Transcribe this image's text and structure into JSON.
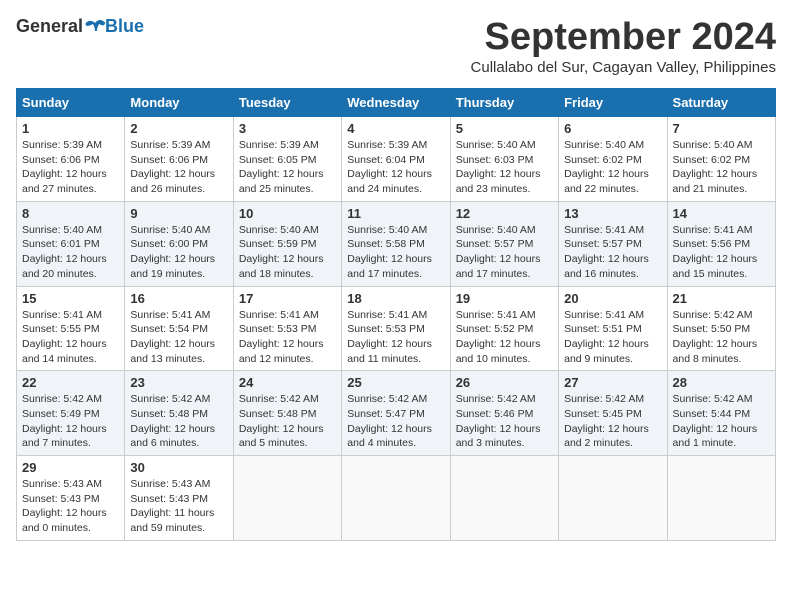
{
  "header": {
    "logo_general": "General",
    "logo_blue": "Blue",
    "month_title": "September 2024",
    "subtitle": "Cullalabo del Sur, Cagayan Valley, Philippines"
  },
  "weekdays": [
    "Sunday",
    "Monday",
    "Tuesday",
    "Wednesday",
    "Thursday",
    "Friday",
    "Saturday"
  ],
  "weeks": [
    [
      {
        "day": "1",
        "sunrise": "5:39 AM",
        "sunset": "6:06 PM",
        "daylight": "12 hours and 27 minutes."
      },
      {
        "day": "2",
        "sunrise": "5:39 AM",
        "sunset": "6:06 PM",
        "daylight": "12 hours and 26 minutes."
      },
      {
        "day": "3",
        "sunrise": "5:39 AM",
        "sunset": "6:05 PM",
        "daylight": "12 hours and 25 minutes."
      },
      {
        "day": "4",
        "sunrise": "5:39 AM",
        "sunset": "6:04 PM",
        "daylight": "12 hours and 24 minutes."
      },
      {
        "day": "5",
        "sunrise": "5:40 AM",
        "sunset": "6:03 PM",
        "daylight": "12 hours and 23 minutes."
      },
      {
        "day": "6",
        "sunrise": "5:40 AM",
        "sunset": "6:02 PM",
        "daylight": "12 hours and 22 minutes."
      },
      {
        "day": "7",
        "sunrise": "5:40 AM",
        "sunset": "6:02 PM",
        "daylight": "12 hours and 21 minutes."
      }
    ],
    [
      {
        "day": "8",
        "sunrise": "5:40 AM",
        "sunset": "6:01 PM",
        "daylight": "12 hours and 20 minutes."
      },
      {
        "day": "9",
        "sunrise": "5:40 AM",
        "sunset": "6:00 PM",
        "daylight": "12 hours and 19 minutes."
      },
      {
        "day": "10",
        "sunrise": "5:40 AM",
        "sunset": "5:59 PM",
        "daylight": "12 hours and 18 minutes."
      },
      {
        "day": "11",
        "sunrise": "5:40 AM",
        "sunset": "5:58 PM",
        "daylight": "12 hours and 17 minutes."
      },
      {
        "day": "12",
        "sunrise": "5:40 AM",
        "sunset": "5:57 PM",
        "daylight": "12 hours and 17 minutes."
      },
      {
        "day": "13",
        "sunrise": "5:41 AM",
        "sunset": "5:57 PM",
        "daylight": "12 hours and 16 minutes."
      },
      {
        "day": "14",
        "sunrise": "5:41 AM",
        "sunset": "5:56 PM",
        "daylight": "12 hours and 15 minutes."
      }
    ],
    [
      {
        "day": "15",
        "sunrise": "5:41 AM",
        "sunset": "5:55 PM",
        "daylight": "12 hours and 14 minutes."
      },
      {
        "day": "16",
        "sunrise": "5:41 AM",
        "sunset": "5:54 PM",
        "daylight": "12 hours and 13 minutes."
      },
      {
        "day": "17",
        "sunrise": "5:41 AM",
        "sunset": "5:53 PM",
        "daylight": "12 hours and 12 minutes."
      },
      {
        "day": "18",
        "sunrise": "5:41 AM",
        "sunset": "5:53 PM",
        "daylight": "12 hours and 11 minutes."
      },
      {
        "day": "19",
        "sunrise": "5:41 AM",
        "sunset": "5:52 PM",
        "daylight": "12 hours and 10 minutes."
      },
      {
        "day": "20",
        "sunrise": "5:41 AM",
        "sunset": "5:51 PM",
        "daylight": "12 hours and 9 minutes."
      },
      {
        "day": "21",
        "sunrise": "5:42 AM",
        "sunset": "5:50 PM",
        "daylight": "12 hours and 8 minutes."
      }
    ],
    [
      {
        "day": "22",
        "sunrise": "5:42 AM",
        "sunset": "5:49 PM",
        "daylight": "12 hours and 7 minutes."
      },
      {
        "day": "23",
        "sunrise": "5:42 AM",
        "sunset": "5:48 PM",
        "daylight": "12 hours and 6 minutes."
      },
      {
        "day": "24",
        "sunrise": "5:42 AM",
        "sunset": "5:48 PM",
        "daylight": "12 hours and 5 minutes."
      },
      {
        "day": "25",
        "sunrise": "5:42 AM",
        "sunset": "5:47 PM",
        "daylight": "12 hours and 4 minutes."
      },
      {
        "day": "26",
        "sunrise": "5:42 AM",
        "sunset": "5:46 PM",
        "daylight": "12 hours and 3 minutes."
      },
      {
        "day": "27",
        "sunrise": "5:42 AM",
        "sunset": "5:45 PM",
        "daylight": "12 hours and 2 minutes."
      },
      {
        "day": "28",
        "sunrise": "5:42 AM",
        "sunset": "5:44 PM",
        "daylight": "12 hours and 1 minute."
      }
    ],
    [
      {
        "day": "29",
        "sunrise": "5:43 AM",
        "sunset": "5:43 PM",
        "daylight": "12 hours and 0 minutes."
      },
      {
        "day": "30",
        "sunrise": "5:43 AM",
        "sunset": "5:43 PM",
        "daylight": "11 hours and 59 minutes."
      },
      null,
      null,
      null,
      null,
      null
    ]
  ]
}
